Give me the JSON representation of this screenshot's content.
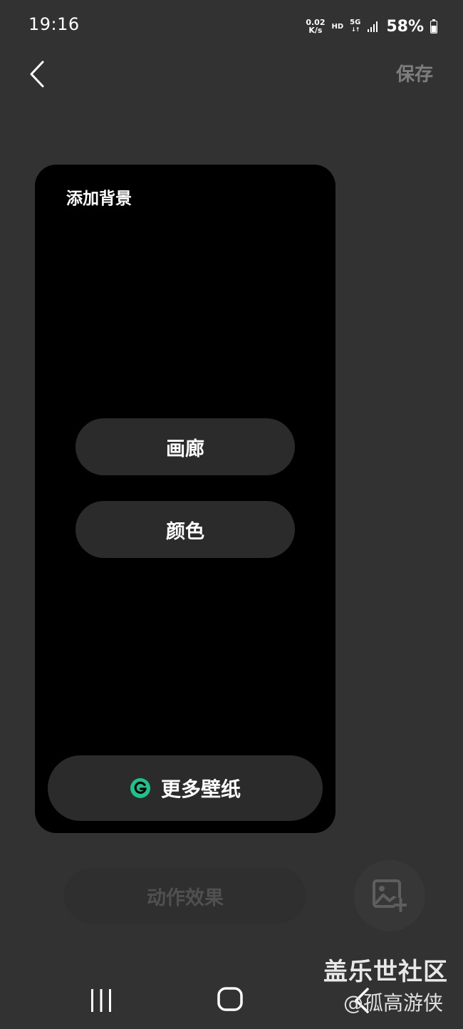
{
  "status_bar": {
    "time": "19:16",
    "net_speed_value": "0.02",
    "net_speed_unit": "K/s",
    "hd": "HD",
    "network": "5G",
    "network_arrows": "↓↑",
    "battery": "58%"
  },
  "header": {
    "save_label": "保存",
    "back_icon": "chevron-left-icon"
  },
  "card": {
    "title": "添加背景",
    "gallery_label": "画廊",
    "color_label": "颜色",
    "more_wallpapers_label": "更多壁纸",
    "more_wallpapers_icon": "galaxy-store-icon",
    "accent_color": "#1ec38b"
  },
  "bottom": {
    "effect_label": "动作效果",
    "add_image_icon": "image-add-icon"
  },
  "watermark": {
    "line1": "盖乐世社区",
    "line2": "@孤高游侠"
  },
  "nav": {
    "recents_icon": "recents-icon",
    "home_icon": "home-icon",
    "back_icon": "back-icon"
  }
}
